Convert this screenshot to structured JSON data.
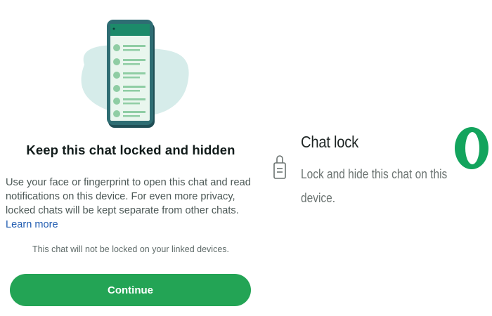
{
  "left": {
    "heading": "Keep this chat locked and hidden",
    "description": "Use your face or fingerprint to open this chat and read notifications on this device. For even more privacy, locked chats will be kept separate from other chats.",
    "learn_more": "Learn more",
    "note": "This chat will not be locked on your linked devices.",
    "continue_label": "Continue"
  },
  "right": {
    "title": "Chat lock",
    "description_line1": "Lock and hide this chat on this",
    "description_line2": "device.",
    "toggle_state": "on"
  },
  "colors": {
    "accent": "#23a455",
    "toggle": "#13a45d",
    "link": "#1f5bb0",
    "illustration_blob": "#d6ecea"
  }
}
